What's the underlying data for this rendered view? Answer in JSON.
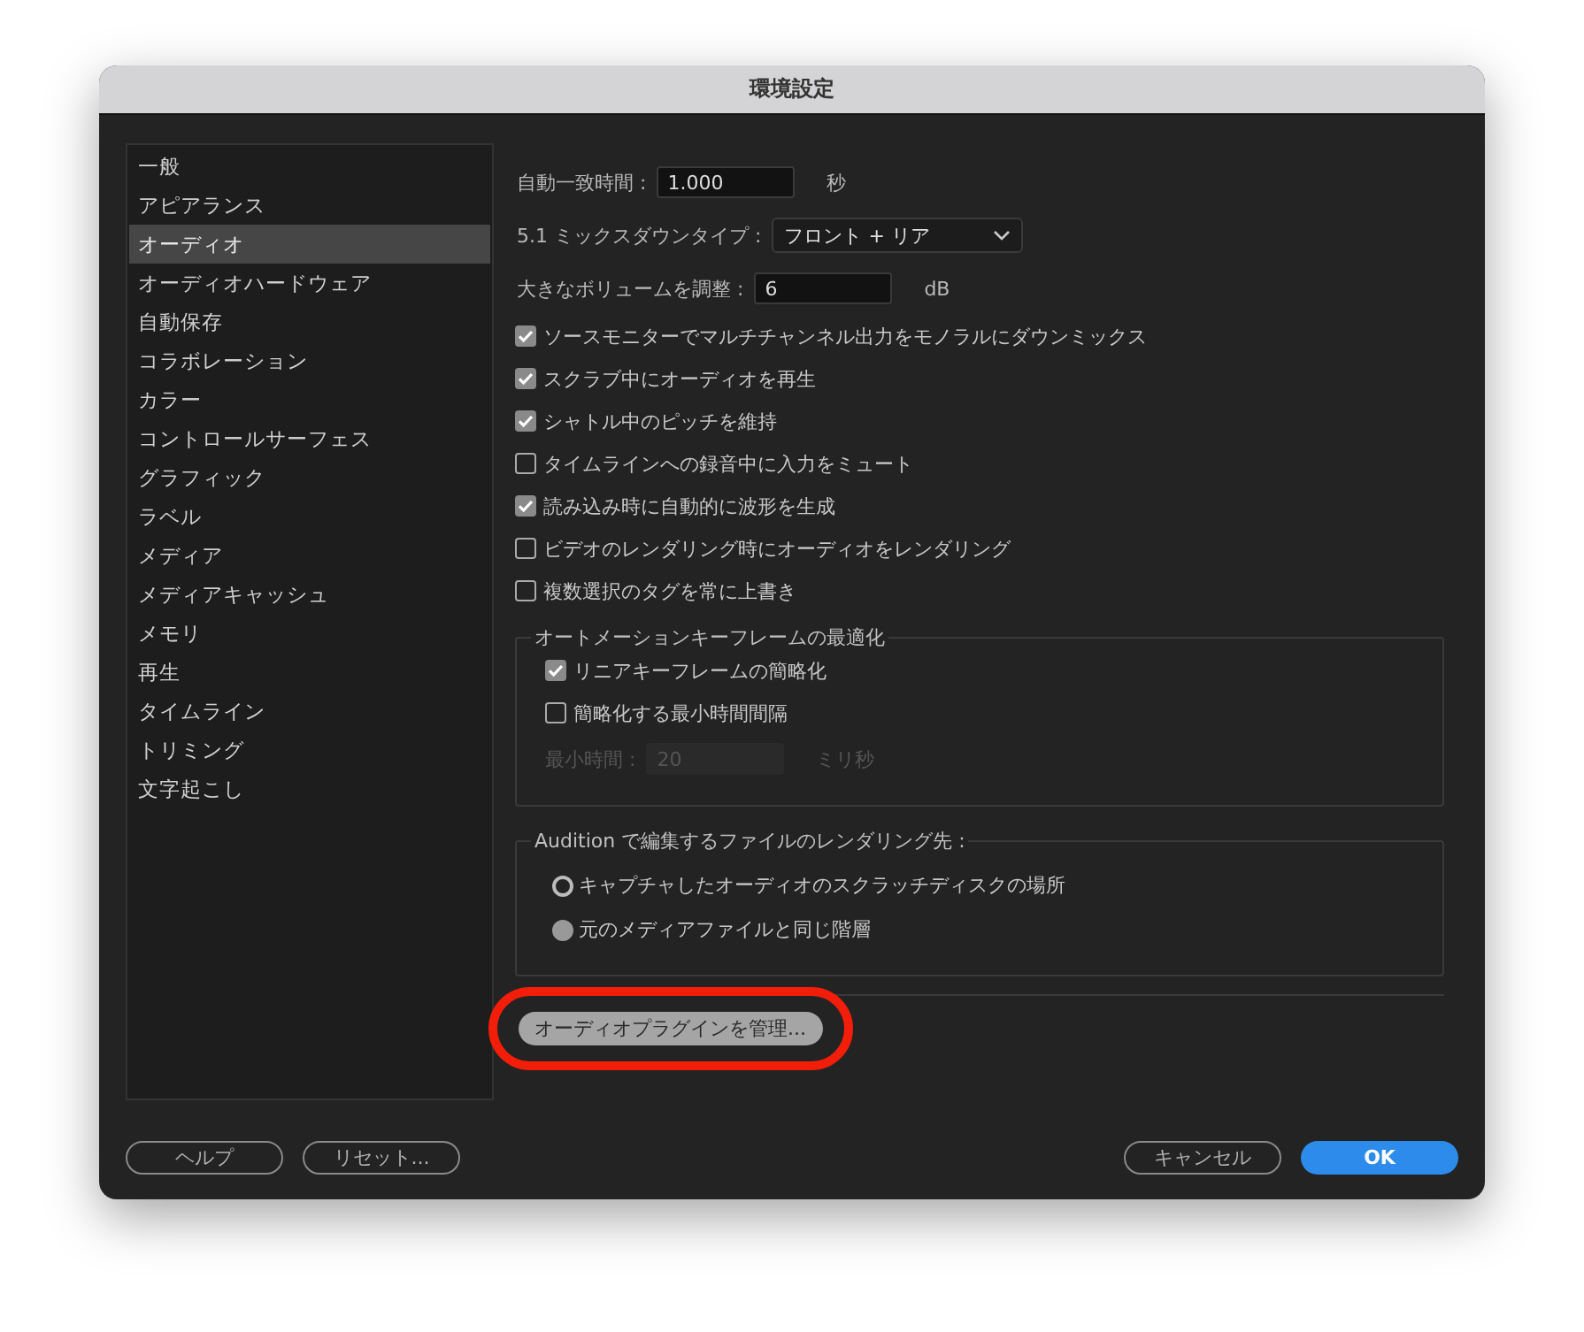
{
  "window": {
    "title": "環境設定"
  },
  "sidebar": {
    "items": [
      {
        "label": "一般",
        "selected": false
      },
      {
        "label": "アピアランス",
        "selected": false
      },
      {
        "label": "オーディオ",
        "selected": true
      },
      {
        "label": "オーディオハードウェア",
        "selected": false
      },
      {
        "label": "自動保存",
        "selected": false
      },
      {
        "label": "コラボレーション",
        "selected": false
      },
      {
        "label": "カラー",
        "selected": false
      },
      {
        "label": "コントロールサーフェス",
        "selected": false
      },
      {
        "label": "グラフィック",
        "selected": false
      },
      {
        "label": "ラベル",
        "selected": false
      },
      {
        "label": "メディア",
        "selected": false
      },
      {
        "label": "メディアキャッシュ",
        "selected": false
      },
      {
        "label": "メモリ",
        "selected": false
      },
      {
        "label": "再生",
        "selected": false
      },
      {
        "label": "タイムライン",
        "selected": false
      },
      {
        "label": "トリミング",
        "selected": false
      },
      {
        "label": "文字起こし",
        "selected": false
      }
    ]
  },
  "fields": [
    {
      "kind": "input",
      "label": "自動一致時間 :",
      "value": "1.000",
      "unit": "秒"
    },
    {
      "kind": "select",
      "label": "5.1 ミックスダウンタイプ :",
      "value": "フロント + リア"
    },
    {
      "kind": "input",
      "label": "大きなボリュームを調整 :",
      "value": "6",
      "unit": "dB"
    }
  ],
  "checkboxes": [
    {
      "label": "ソースモニターでマルチチャンネル出力をモノラルにダウンミックス",
      "checked": true
    },
    {
      "label": "スクラブ中にオーディオを再生",
      "checked": true
    },
    {
      "label": "シャトル中のピッチを維持",
      "checked": true
    },
    {
      "label": "タイムラインへの録音中に入力をミュート",
      "checked": false
    },
    {
      "label": "読み込み時に自動的に波形を生成",
      "checked": true
    },
    {
      "label": "ビデオのレンダリング時にオーディオをレンダリング",
      "checked": false
    },
    {
      "label": "複数選択のタグを常に上書き",
      "checked": false
    }
  ],
  "automation": {
    "title": "オートメーションキーフレームの最適化",
    "checkboxes": [
      {
        "label": "リニアキーフレームの簡略化",
        "checked": true
      },
      {
        "label": "簡略化する最小時間間隔",
        "checked": false
      }
    ],
    "min_time": {
      "label": "最小時間 :",
      "value": "20",
      "unit": "ミリ秒",
      "disabled": true
    }
  },
  "render_target": {
    "title": "Audition で編集するファイルのレンダリング先 :",
    "options": [
      {
        "label": "キャプチャしたオーディオのスクラッチディスクの場所",
        "selected": false
      },
      {
        "label": "元のメディアファイルと同じ階層",
        "selected": true
      }
    ]
  },
  "plugin_button": {
    "label": "オーディオプラグインを管理...",
    "annotated": true
  },
  "footer": {
    "left": [
      "ヘルプ",
      "リセット..."
    ],
    "cancel": "キャンセル",
    "ok": "OK"
  }
}
